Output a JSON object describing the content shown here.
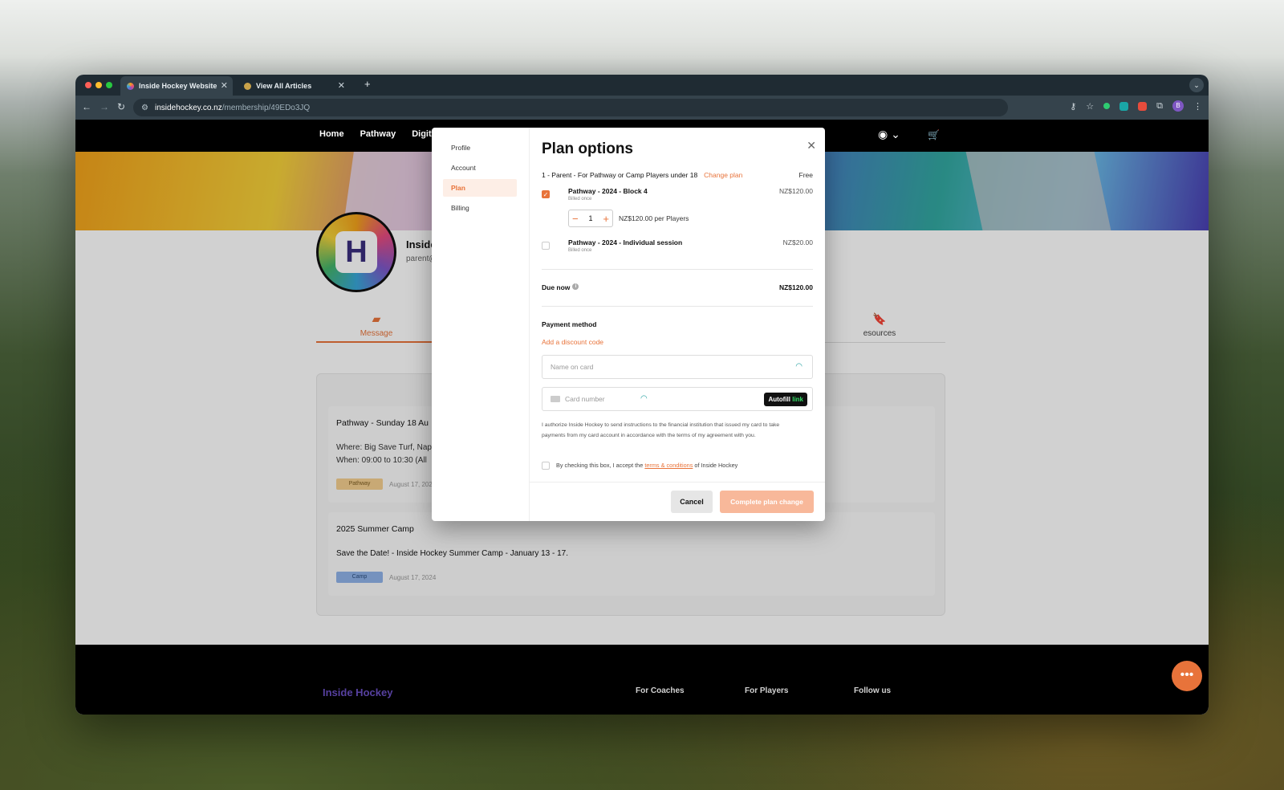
{
  "browser": {
    "tabs": [
      {
        "title": "Inside Hockey Website",
        "active": true
      },
      {
        "title": "View All Articles",
        "active": false
      }
    ],
    "url_host": "insidehockey.co.nz",
    "url_path": "/membership/49EDo3JQ",
    "profile_initial": "B"
  },
  "site": {
    "nav": [
      "Home",
      "Pathway",
      "Digital"
    ],
    "profile_name": "Inside",
    "profile_email": "parent@",
    "tabs": {
      "messages": "Message",
      "resources": "esources"
    },
    "feed": [
      {
        "title": "Pathway - Sunday 18 Au",
        "where": "Where: Big Save Turf, Nap",
        "when": "When: 09:00 to 10:30 (All",
        "badge": "Pathway",
        "date": "August 17, 202"
      },
      {
        "title": "2025 Summer Camp",
        "body": "Save the Date! - Inside Hockey Summer Camp - January 13 - 17.",
        "badge": "Camp",
        "date": "August 17, 2024"
      }
    ],
    "footer": {
      "brand": "Inside Hockey",
      "cols": [
        "For Coaches",
        "For Players",
        "Follow us"
      ]
    }
  },
  "modal": {
    "side": [
      "Profile",
      "Account",
      "Plan",
      "Billing"
    ],
    "active_side": "Plan",
    "title": "Plan options",
    "plan_label": "1 - Parent - For Pathway or Camp Players under 18",
    "change_plan": "Change plan",
    "plan_price": "Free",
    "options": [
      {
        "name": "Pathway - 2024 - Block 4",
        "sub": "Billed once",
        "price": "NZ$120.00",
        "checked": true
      },
      {
        "name": "Pathway - 2024 - Individual session",
        "sub": "Billed once",
        "price": "NZ$20.00",
        "checked": false
      }
    ],
    "quantity": "1",
    "per_player": "NZ$120.00 per Players",
    "due_label": "Due now",
    "due_amount": "NZ$120.00",
    "payment_method": "Payment method",
    "discount": "Add a discount code",
    "name_placeholder": "Name on card",
    "card_placeholder": "Card number",
    "autofill": "Autofill",
    "autofill_link": "link",
    "authorization": "I authorize Inside Hockey to send instructions to the financial institution that issued my card to take payments from my card account in accordance with the terms of my agreement with you.",
    "terms_pre": "By checking this box, I accept the ",
    "terms_link": "terms & conditions",
    "terms_post": " of Inside Hockey",
    "cancel": "Cancel",
    "complete": "Complete plan change"
  },
  "colors": {
    "accent": "#e8733a",
    "tab_bar": "#1f2b33",
    "toolbar": "#35434c"
  }
}
